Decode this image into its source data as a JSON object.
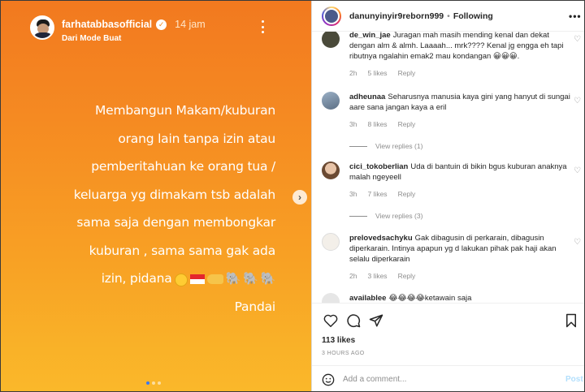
{
  "story": {
    "username": "farhatabbasofficial",
    "verified_icon": "verified-badge-icon",
    "time": "14 jam",
    "subtitle": "Dari Mode Buat",
    "text_lines": [
      "Membangun  Makam/kuburan",
      "orang lain tanpa izin atau",
      "pemberitahuan ke orang tua  /",
      "keluarga yg dimakam tsb adalah",
      "sama saja dengan membongkar",
      "kuburan , sama sama gak ada"
    ],
    "last_line_text": "izin, pidana",
    "signature": "Pandai",
    "background_colors": [
      "#f2791f",
      "#fab82a"
    ]
  },
  "post": {
    "username": "danunyinyir9reborn999",
    "separator": "•",
    "follow_status": "Following",
    "more": "•••"
  },
  "comments": [
    {
      "username": "de_win_jae",
      "text": "Juragan mah masih mending kenal dan dekat dengan alm & almh. Laaaah... mrk???? Kenal jg engga eh tapi ributnya ngalahin emak2 mau kondangan 😀😀😀.",
      "time": "2h",
      "likes": "5 likes",
      "reply": "Reply"
    },
    {
      "username": "adheunaa",
      "text": "Seharusnya manusia kaya gini yang hanyut di sungai aare sana jangan kaya a eril",
      "time": "3h",
      "likes": "8 likes",
      "reply": "Reply",
      "view_replies": "View replies (1)"
    },
    {
      "username": "cici_tokoberlian",
      "text": "Uda di bantuin di bikin bgus kuburan anaknya malah ngeyeell",
      "time": "3h",
      "likes": "7 likes",
      "reply": "Reply",
      "view_replies": "View replies (3)"
    },
    {
      "username": "prelovedsachyku",
      "text": "Gak dibagusin di perkarain, dibagusin diperkarain. Intinya apapun yg d lakukan pihak pak haji akan selalu diperkarain",
      "time": "2h",
      "likes": "3 likes",
      "reply": "Reply"
    },
    {
      "username": "availablee",
      "text": "😂😂😂😂ketawain saja"
    }
  ],
  "actions": {
    "likes": "113 likes",
    "time_ago": "3 HOURS AGO",
    "add_comment_placeholder": "Add a comment...",
    "post_label": "Post"
  }
}
